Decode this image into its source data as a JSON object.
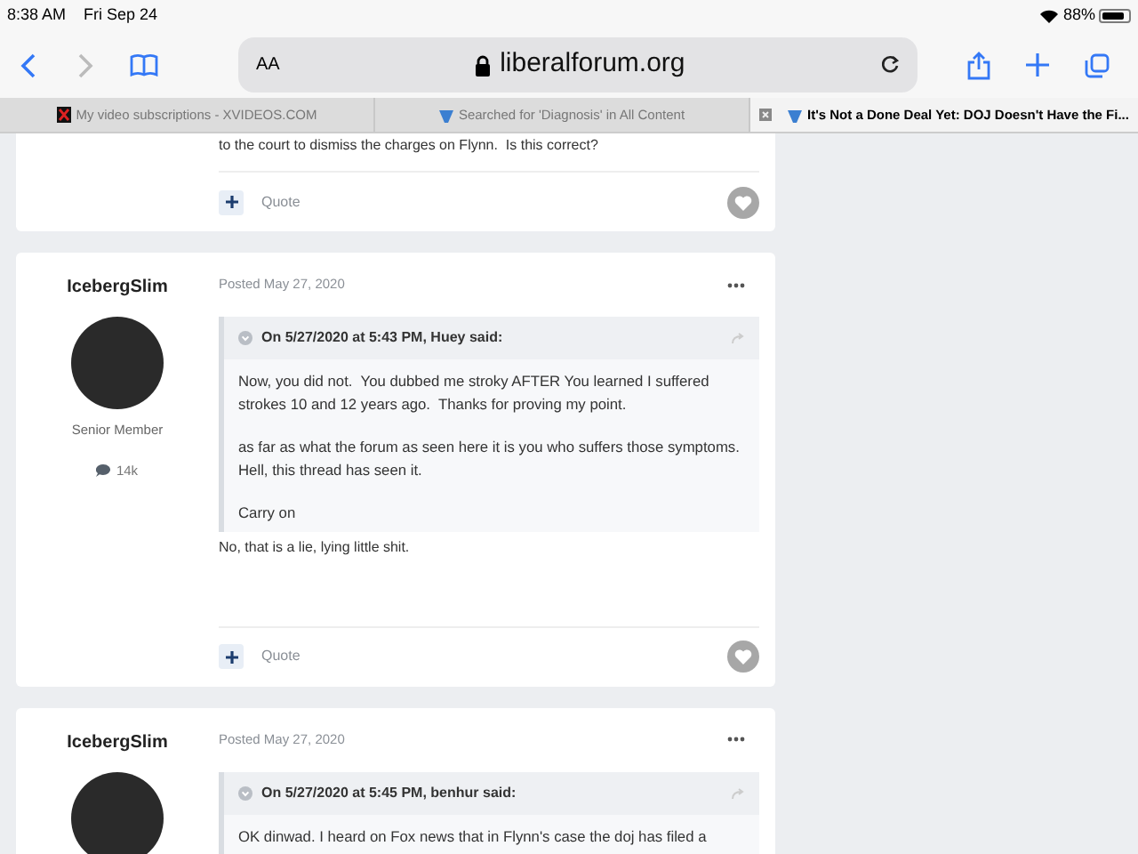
{
  "status_bar": {
    "time": "8:38 AM",
    "date": "Fri Sep 24",
    "battery": "88%"
  },
  "toolbar": {
    "reader_label": "AA",
    "url": "liberalforum.org"
  },
  "tabs": [
    {
      "title": "My video subscriptions - XVIDEOS.COM",
      "kind": "x",
      "selected": false
    },
    {
      "title": "Searched for 'Diagnosis' in All Content",
      "kind": "forum",
      "selected": false
    },
    {
      "title": "It's Not a Done Deal Yet: DOJ Doesn't Have the Fi...",
      "kind": "forum",
      "selected": true
    }
  ],
  "posts": [
    {
      "body": "to the court to dismiss the charges on Flynn.  Is this correct?",
      "quote_label": "Quote"
    },
    {
      "author": "IcebergSlim",
      "role": "Senior Member",
      "count": "14k",
      "posted": "Posted May 27, 2020",
      "quote": {
        "header": "On 5/27/2020 at 5:43 PM, Huey said:",
        "paragraphs": [
          "Now, you did not.  You dubbed me stroky AFTER You learned I suffered strokes 10 and 12 years ago.  Thanks for proving my point.",
          "as far as what the forum as seen here it is you who suffers those symptoms.  Hell, this thread has seen it.",
          "Carry on"
        ]
      },
      "body": "No, that is a lie, lying little shit.",
      "quote_label": "Quote"
    },
    {
      "author": "IcebergSlim",
      "posted": "Posted May 27, 2020",
      "quote": {
        "header": "On 5/27/2020 at 5:45 PM, benhur said:",
        "paragraphs": [
          "OK dinwad. I heard on Fox news that in Flynn's case the doj has filed a"
        ]
      }
    }
  ]
}
